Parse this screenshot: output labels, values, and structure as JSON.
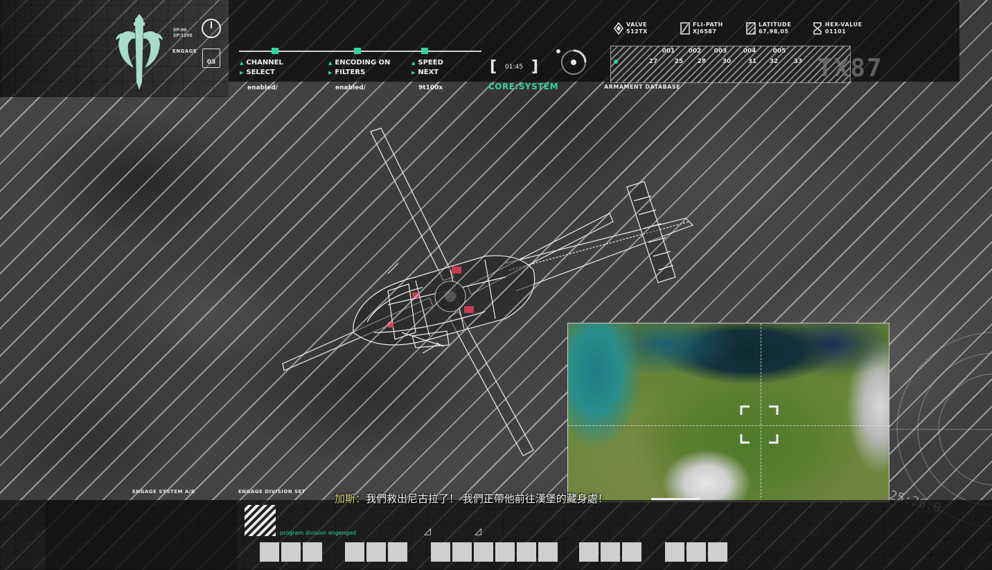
{
  "hud": {
    "emblem_stats": [
      "SP:00",
      "SP:1205"
    ],
    "engage": {
      "label": "ENGAGE",
      "value": "03"
    },
    "controls": [
      {
        "line1": "CHANNEL",
        "line2": "SELECT",
        "status": "enabled/"
      },
      {
        "line1": "ENCODING ON",
        "line2": "FILTERS",
        "status": "enabled/"
      },
      {
        "line1": "SPEED",
        "line2": "NEXT",
        "status": "9t100x"
      }
    ],
    "timer": "01:45",
    "core_system": "CORE:SYSTEM",
    "info": [
      {
        "icon": "diamond-icon",
        "title": "VALVE",
        "value": "512TX"
      },
      {
        "icon": "slash-box-icon",
        "title": "FLI-PATH",
        "value": "XJ6587"
      },
      {
        "icon": "hatched-box-icon",
        "title": "LATITUDE",
        "value": "67,98,05"
      },
      {
        "icon": "hourglass-icon",
        "title": "HEX-VALUE",
        "value": "01101"
      }
    ],
    "armament": {
      "label": "ARMAMENT DATABASE",
      "row1": [
        "001",
        "002",
        "003",
        "004",
        "005"
      ],
      "row2": [
        "27",
        "25",
        "28",
        "30",
        "31",
        "32",
        "33"
      ],
      "code": "TX87"
    }
  },
  "bottom": {
    "engage_system": "ENGAGE SYSTEM A/B",
    "engage_division": "ENGAGE DIVISION SET",
    "program_division": "program division engenged",
    "subtitle_speaker": "加斯：",
    "subtitle_text": "我們救出尼古拉了！ 我們正帶他前往漢堡的藏身處！",
    "radar_readout": "25:26:0",
    "slot_groups": [
      3,
      3,
      6,
      3,
      3
    ]
  },
  "colors": {
    "accent": "#2fd6a0",
    "speaker": "#d9d37a"
  }
}
